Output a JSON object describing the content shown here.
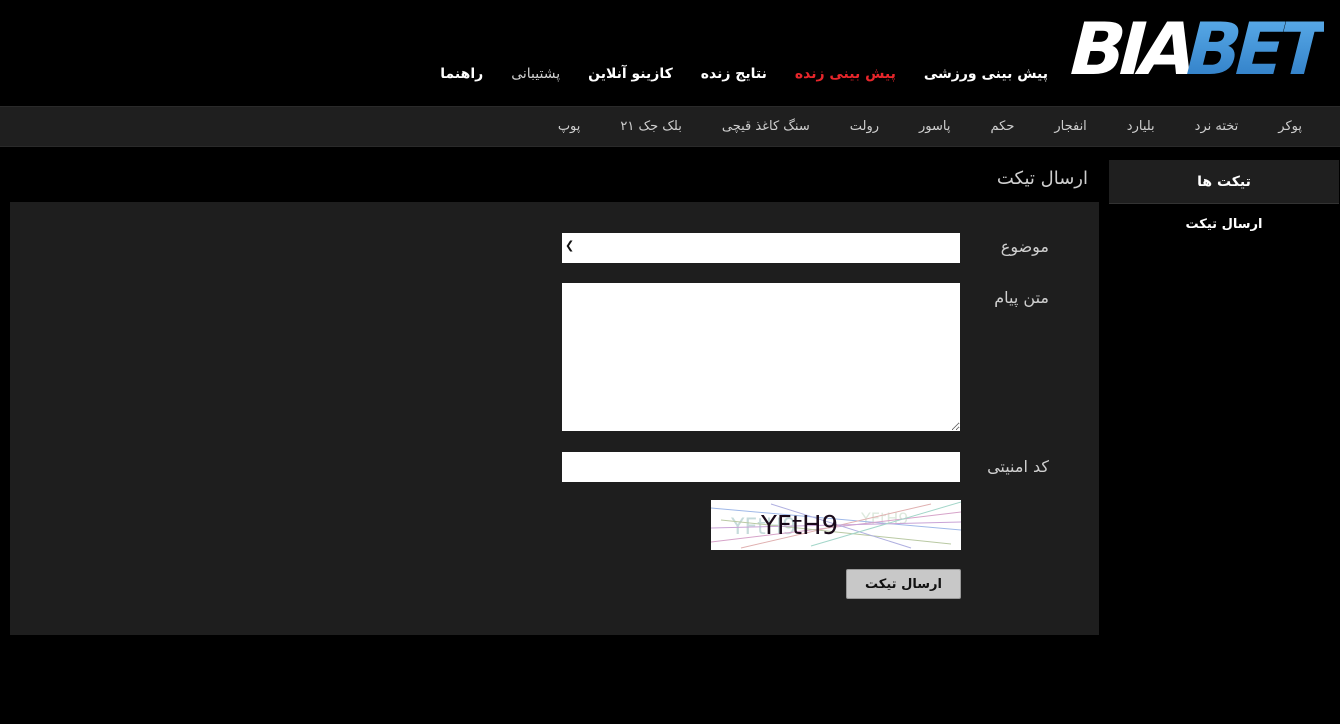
{
  "brand": {
    "logo_text": "BIABET",
    "colors": {
      "primary": "#ffffff",
      "accent": "#3a8fd8"
    }
  },
  "main_nav": [
    {
      "label": "پیش بینی ورزشی"
    },
    {
      "label": "پیش بینی زنده"
    },
    {
      "label": "نتایج زنده"
    },
    {
      "label": "کازینو آنلاین"
    },
    {
      "label": "پشتیبانی"
    },
    {
      "label": "راهنما"
    }
  ],
  "games_nav": [
    {
      "label": "پوکر"
    },
    {
      "label": "تخته نرد"
    },
    {
      "label": "بلیارد"
    },
    {
      "label": "انفجار"
    },
    {
      "label": "حکم"
    },
    {
      "label": "پاسور"
    },
    {
      "label": "رولت"
    },
    {
      "label": "سنگ کاغذ قیچی"
    },
    {
      "label": "بلک جک ۲۱"
    },
    {
      "label": "پوپ"
    }
  ],
  "sidebar": {
    "title": "تیکت ها",
    "items": [
      {
        "label": "ارسال تیکت"
      }
    ]
  },
  "form": {
    "title": "ارسال تیکت",
    "subject_label": "موضوع",
    "subject_value": "",
    "message_label": "متن پیام",
    "message_value": "",
    "captcha_label": "کد امنیتی",
    "captcha_value": "",
    "captcha_text": "YFtH9",
    "submit_label": "ارسال تیکت"
  },
  "colors": {
    "background": "#000000",
    "panel": "#1e1e1e",
    "bar": "#1f1f1f",
    "active_nav": "#e8262b",
    "button": "#c8c8c8"
  },
  "icons": {
    "select": "chevron-down-icon"
  }
}
